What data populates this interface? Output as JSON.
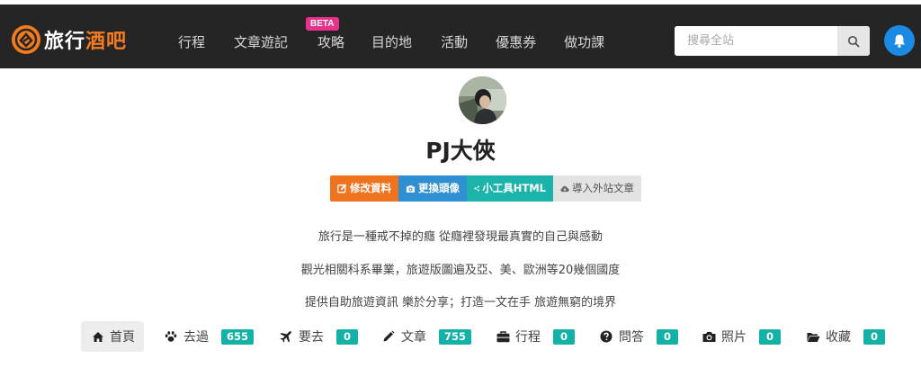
{
  "header": {
    "logo_part1": "旅行",
    "logo_part2": "酒吧",
    "nav": [
      {
        "label": "行程"
      },
      {
        "label": "文章遊記"
      },
      {
        "label": "攻略",
        "badge": "BETA"
      },
      {
        "label": "目的地"
      },
      {
        "label": "活動"
      },
      {
        "label": "優惠券"
      },
      {
        "label": "做功課"
      }
    ],
    "search_placeholder": "搜尋全站"
  },
  "profile": {
    "name": "PJ大俠",
    "actions": [
      "修改資料",
      "更換頭像",
      "小工具HTML",
      "導入外站文章"
    ],
    "bio": [
      "旅行是一種戒不掉的癮 從癮裡發現最真實的自己與感動",
      "觀光相關科系畢業，旅遊版圖遍及亞、美、歐洲等20幾個國度",
      "提供自助旅遊資訊 樂於分享；打造一文在手 旅遊無窮的境界"
    ]
  },
  "tabs": [
    {
      "label": "首頁",
      "icon": "home-icon"
    },
    {
      "label": "去過",
      "icon": "paw-icon",
      "count": "655"
    },
    {
      "label": "要去",
      "icon": "plane-icon",
      "count": "0"
    },
    {
      "label": "文章",
      "icon": "pencil-icon",
      "count": "755"
    },
    {
      "label": "行程",
      "icon": "briefcase-icon",
      "count": "0"
    },
    {
      "label": "問答",
      "icon": "question-icon",
      "count": "0"
    },
    {
      "label": "照片",
      "icon": "camera-icon",
      "count": "0"
    },
    {
      "label": "收藏",
      "icon": "folder-icon",
      "count": "0"
    }
  ],
  "colors": {
    "brand_orange": "#f47b20",
    "topbar": "#252525",
    "badge_teal": "#14b2a6",
    "beta_pink": "#e8318b",
    "bell_blue": "#1a8ae4"
  }
}
